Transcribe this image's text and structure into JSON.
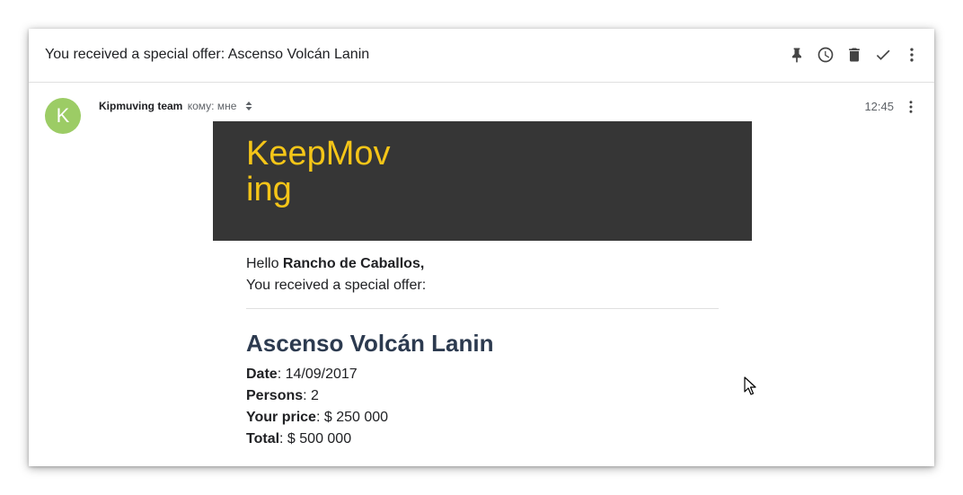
{
  "email": {
    "subject": "You received a special offer: Ascenso Volcán Lanin",
    "sender": {
      "initial": "K",
      "name": "Kipmuving team",
      "to_label": "кому:",
      "to_value": "мне"
    },
    "time": "12:45"
  },
  "toolbar": {
    "icons": [
      "pin-icon",
      "clock-icon",
      "trash-icon",
      "check-icon",
      "more-vert-icon"
    ]
  },
  "body": {
    "brand_line1": "KeepMov",
    "brand_line2": "ing",
    "greeting_prefix": "Hello",
    "customer_name": "Rancho de Caballos",
    "greeting_suffix": ",",
    "intro": "You received a special offer:",
    "offer_title": "Ascenso Volcán Lanin",
    "details": {
      "date_label": "Date",
      "date_value": ": 14/09/2017",
      "persons_label": "Persons",
      "persons_value": ": 2",
      "price_label": "Your price",
      "price_value": ": $ 250 000",
      "total_label": "Total",
      "total_value": ": $ 500 000"
    }
  },
  "colors": {
    "banner_bg": "#363636",
    "brand_yellow": "#f5c518",
    "avatar_green": "#9ccc65",
    "title_navy": "#2c3a4f"
  }
}
